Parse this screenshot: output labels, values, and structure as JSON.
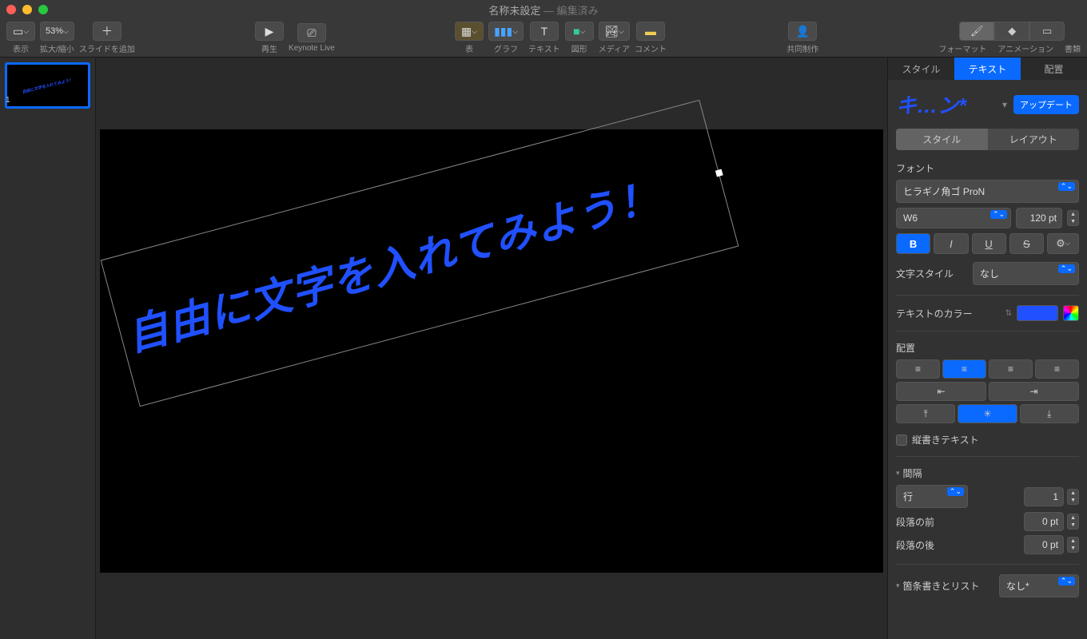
{
  "window": {
    "title": "名称未設定",
    "edited": "編集済み"
  },
  "toolbar": {
    "view": "表示",
    "zoom_val": "53%",
    "zoom_label": "拡大/縮小",
    "add_slide": "スライドを追加",
    "play": "再生",
    "keynote_live": "Keynote Live",
    "table": "表",
    "chart": "グラフ",
    "text": "テキスト",
    "shape": "図形",
    "media": "メディア",
    "comment": "コメント",
    "collab": "共同制作",
    "format": "フォーマット",
    "animate": "アニメーション",
    "document": "書類"
  },
  "sidebar": {
    "slide_num": "1"
  },
  "slide": {
    "text": "自由に文字を入れてみよう！"
  },
  "inspector": {
    "tabs": {
      "style": "スタイル",
      "text": "テキスト",
      "arrange": "配置"
    },
    "style_name": "キ…ン*",
    "update": "アップデート",
    "seg": {
      "style": "スタイル",
      "layout": "レイアウト"
    },
    "font_label": "フォント",
    "font_family": "ヒラギノ角ゴ ProN",
    "font_weight": "W6",
    "font_size": "120 pt",
    "char_style_label": "文字スタイル",
    "char_style_val": "なし",
    "text_color_label": "テキストのカラー",
    "align_label": "配置",
    "vertical_text": "縦書きテキスト",
    "spacing_label": "間隔",
    "line_label": "行",
    "line_val": "1",
    "before_label": "段落の前",
    "before_val": "0 pt",
    "after_label": "段落の後",
    "after_val": "0 pt",
    "bullets_label": "箇条書きとリスト",
    "bullets_val": "なし*"
  }
}
